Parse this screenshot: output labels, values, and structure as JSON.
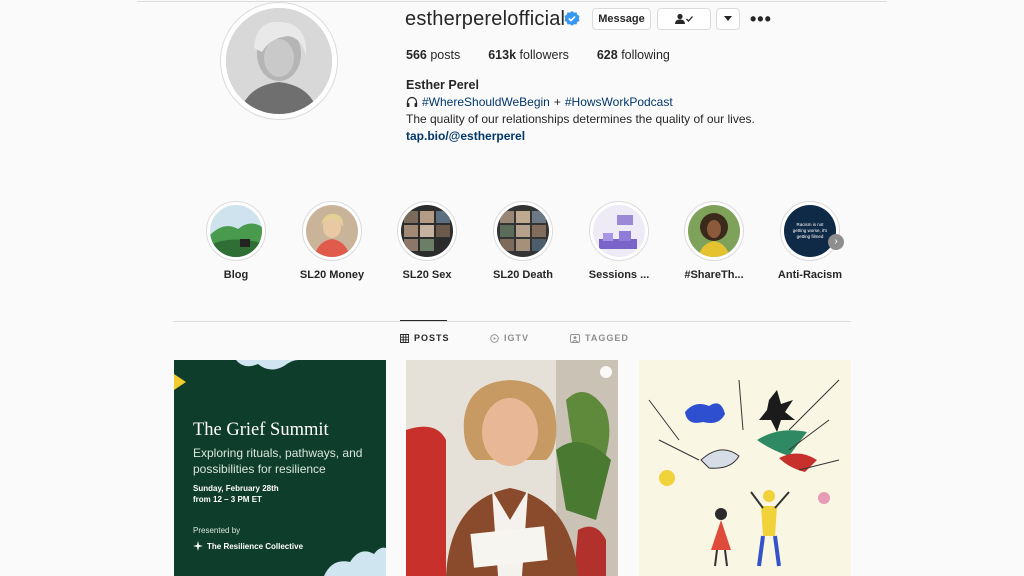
{
  "profile": {
    "username": "estherperelofficial",
    "verified_icon": "verified-badge-icon",
    "message_label": "Message",
    "follow_icon": "person-check-icon",
    "dropdown_icon": "caret-down-icon",
    "more_icon": "more-options-icon"
  },
  "stats": {
    "posts_count": "566",
    "posts_label": "posts",
    "followers_count": "613k",
    "followers_label": "followers",
    "following_count": "628",
    "following_label": "following"
  },
  "bio": {
    "full_name": "Esther Perel",
    "headphones_icon": "headphones-icon",
    "hashtag_1": "#WhereShouldWeBegin",
    "joiner": "+",
    "hashtag_2": "#HowsWorkPodcast",
    "tagline": "The quality of our relationships determines the quality of our lives.",
    "link": "tap.bio/@estherperel"
  },
  "highlights": [
    {
      "label": "Blog"
    },
    {
      "label": "SL20 Money"
    },
    {
      "label": "SL20 Sex"
    },
    {
      "label": "SL20 Death"
    },
    {
      "label": "Sessions ..."
    },
    {
      "label": "#ShareTh..."
    },
    {
      "label": "Anti-Racism",
      "cover_text": "Racism is not getting worse, it's getting filmed"
    }
  ],
  "tabs": [
    {
      "label": "POSTS",
      "icon": "grid-icon",
      "active": true
    },
    {
      "label": "IGTV",
      "icon": "igtv-icon",
      "active": false
    },
    {
      "label": "TAGGED",
      "icon": "tagged-icon",
      "active": false
    }
  ],
  "posts": {
    "post1": {
      "title": "The Grief Summit",
      "subtitle": "Exploring rituals, pathways, and possibilities for resilience",
      "date_line1": "Sunday, February 28th",
      "date_line2": "from 12 – 3 PM ET",
      "presented_by": "Presented by",
      "organization": "The Resilience Collective"
    }
  },
  "colors": {
    "link": "#00376b",
    "verified": "#3897f0",
    "post1_bg": "#0f3d2b"
  }
}
